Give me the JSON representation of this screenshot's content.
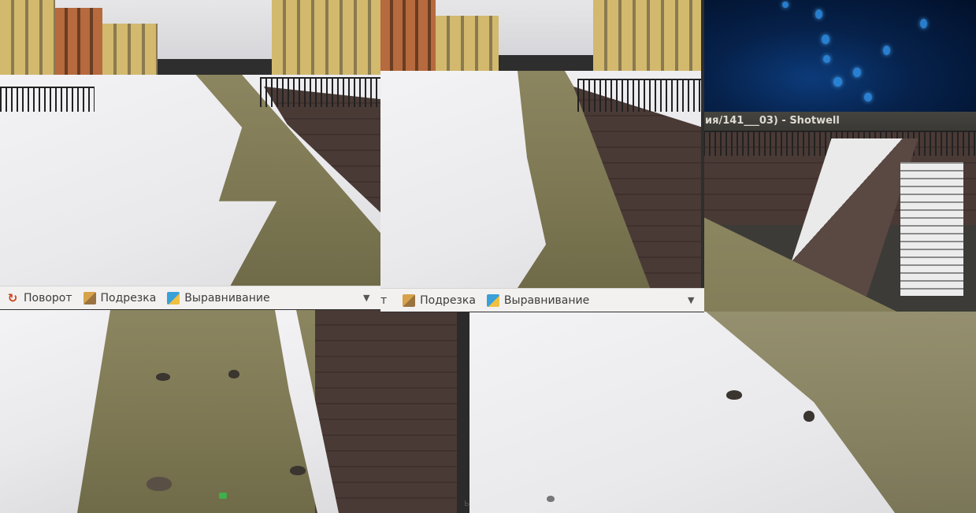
{
  "back_window": {
    "title": "ия/141___03) - Shotwell"
  },
  "toolbar_front": {
    "rotate_label": "Поворот",
    "crop_label": "Подрезка",
    "straighten_label": "Выравнивание",
    "dropdown_glyph": "▼"
  },
  "toolbar_middle": {
    "partial_label": "т",
    "crop_label": "Подрезка",
    "straighten_label": "Выравнивание",
    "dropdown_glyph": "▼"
  },
  "bottom_middle_glyph": "ь",
  "icons": {
    "rotate": "rotate-icon",
    "crop": "crop-icon",
    "straighten": "straighten-icon",
    "dropdown": "chevron-down-icon"
  },
  "colors": {
    "toolbar_bg": "#f2f1f0",
    "titlebar_bg": "#3c3b37",
    "wallpaper": "#06214a"
  }
}
